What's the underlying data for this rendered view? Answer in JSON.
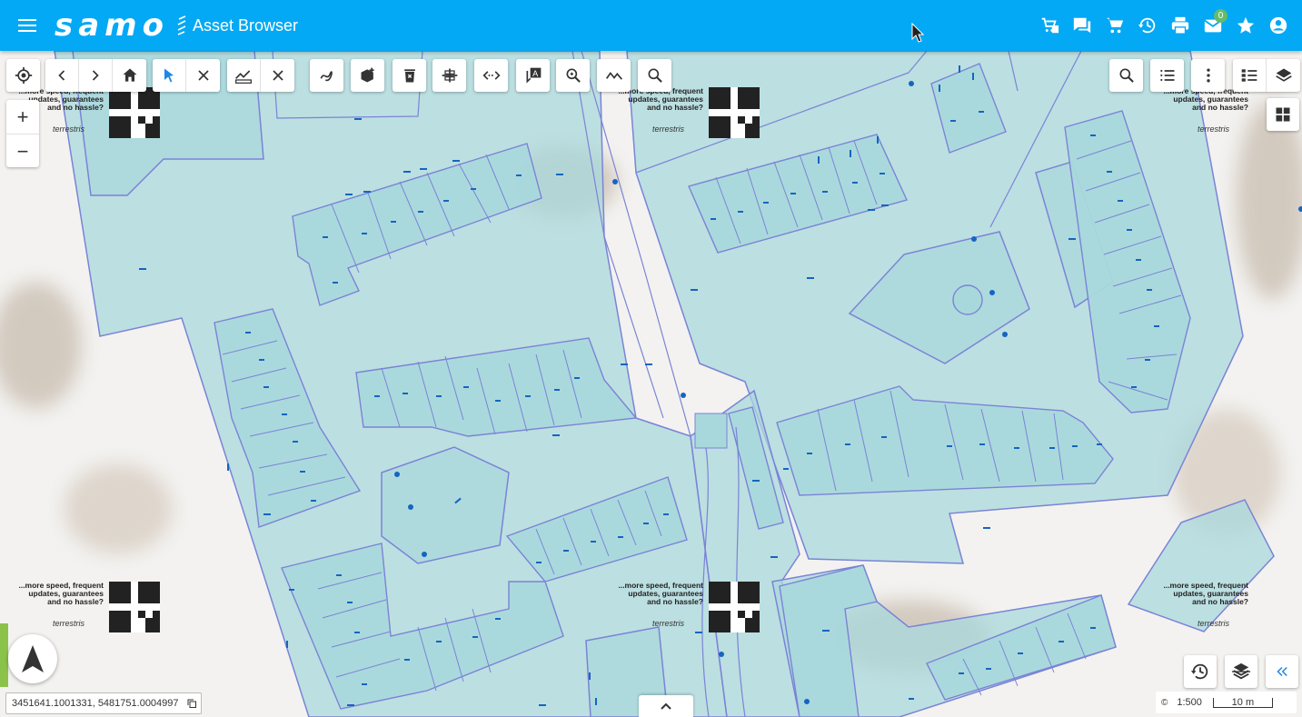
{
  "header": {
    "logo_text": "samo",
    "title": "Asset Browser",
    "mail_badge": "0",
    "icons": [
      "cart-list-icon",
      "chat-icon",
      "cart-icon",
      "history-icon",
      "print-icon",
      "mail-icon",
      "star-icon",
      "account-icon"
    ]
  },
  "toolbar": {
    "tools": [
      "locate-icon",
      "back-icon",
      "forward-icon",
      "home-icon",
      "select-pointer-icon",
      "clear-select-icon",
      "measure-graph-icon",
      "clear-measure-icon",
      "draw-freehand-icon",
      "add-object-icon",
      "delete-icon",
      "split-icon",
      "distance-icon",
      "label-icon",
      "zoom-area-icon",
      "profile-icon",
      "search-icon"
    ]
  },
  "right_toolbar": [
    "search-icon",
    "list-icon",
    "more-vert-icon",
    "legend-icon",
    "layers-icon"
  ],
  "watermark": {
    "text": "...more speed, frequent updates, guarantees and no hassle?",
    "brand": "terrestris"
  },
  "map_footer": {
    "coordinates": "3451641.1001331, 5481751.0004997",
    "scale": "1:500",
    "scalebar_label": "10 m"
  },
  "colors": {
    "header": "#03a9f4",
    "parcel_fill": "#a9d8dc",
    "parcel_stroke": "#7b83d6",
    "marker": "#1565c0"
  }
}
